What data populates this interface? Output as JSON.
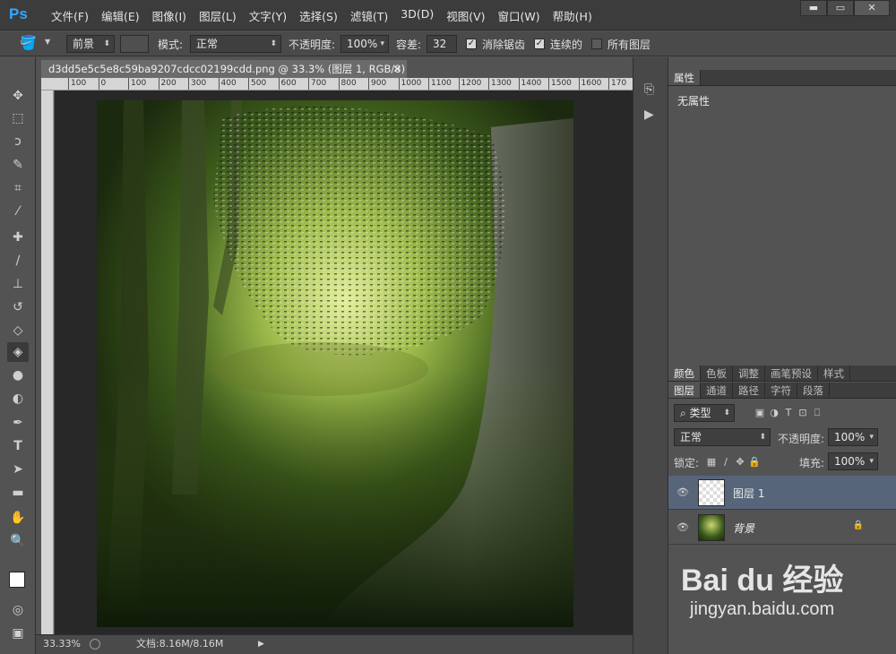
{
  "app": {
    "logo": "Ps"
  },
  "menu": [
    "文件(F)",
    "编辑(E)",
    "图像(I)",
    "图层(L)",
    "文字(Y)",
    "选择(S)",
    "滤镜(T)",
    "3D(D)",
    "视图(V)",
    "窗口(W)",
    "帮助(H)"
  ],
  "window_controls": {
    "minimize": "▬",
    "maximize": "▭",
    "close": "✕"
  },
  "options": {
    "fill_source": "前景",
    "mode_label": "模式:",
    "mode_value": "正常",
    "opacity_label": "不透明度:",
    "opacity_value": "100%",
    "tolerance_label": "容差:",
    "tolerance_value": "32",
    "antialias_label": "消除锯齿",
    "contiguous_label": "连续的",
    "all_layers_label": "所有图层",
    "antialias_checked": true,
    "contiguous_checked": true,
    "all_layers_checked": false
  },
  "document": {
    "tab_title": "d3dd5e5c5e8c59ba9207cdcc02199cdd.png @ 33.3% (图层 1, RGB/8) *",
    "ruler_ticks": [
      "100",
      "0",
      "100",
      "200",
      "300",
      "400",
      "500",
      "600",
      "700",
      "800",
      "900",
      "1000",
      "1100",
      "1200",
      "1300",
      "1400",
      "1500",
      "1600",
      "170"
    ]
  },
  "status": {
    "zoom": "33.33%",
    "doc_info": "文档:8.16M/8.16M"
  },
  "properties_panel": {
    "title": "属性",
    "content": "无属性"
  },
  "color_panel_tabs": [
    "颜色",
    "色板",
    "调整",
    "画笔预设",
    "样式"
  ],
  "layers_panel_tabs": [
    "图层",
    "通道",
    "路径",
    "字符",
    "段落"
  ],
  "layers_controls": {
    "filter_kind": "类型",
    "blend_mode": "正常",
    "opacity_label": "不透明度:",
    "opacity_value": "100%",
    "lock_label": "锁定:",
    "fill_label": "填充:",
    "fill_value": "100%"
  },
  "layers": [
    {
      "name": "图层 1",
      "selected": true
    },
    {
      "name": "背景",
      "selected": false
    }
  ],
  "watermark": {
    "brand": "Bai du 经验",
    "url": "jingyan.baidu.com"
  },
  "colors": {
    "accent": "#31a8ff",
    "selected_layer": "#56657a",
    "canvas_bg": "#282828"
  }
}
